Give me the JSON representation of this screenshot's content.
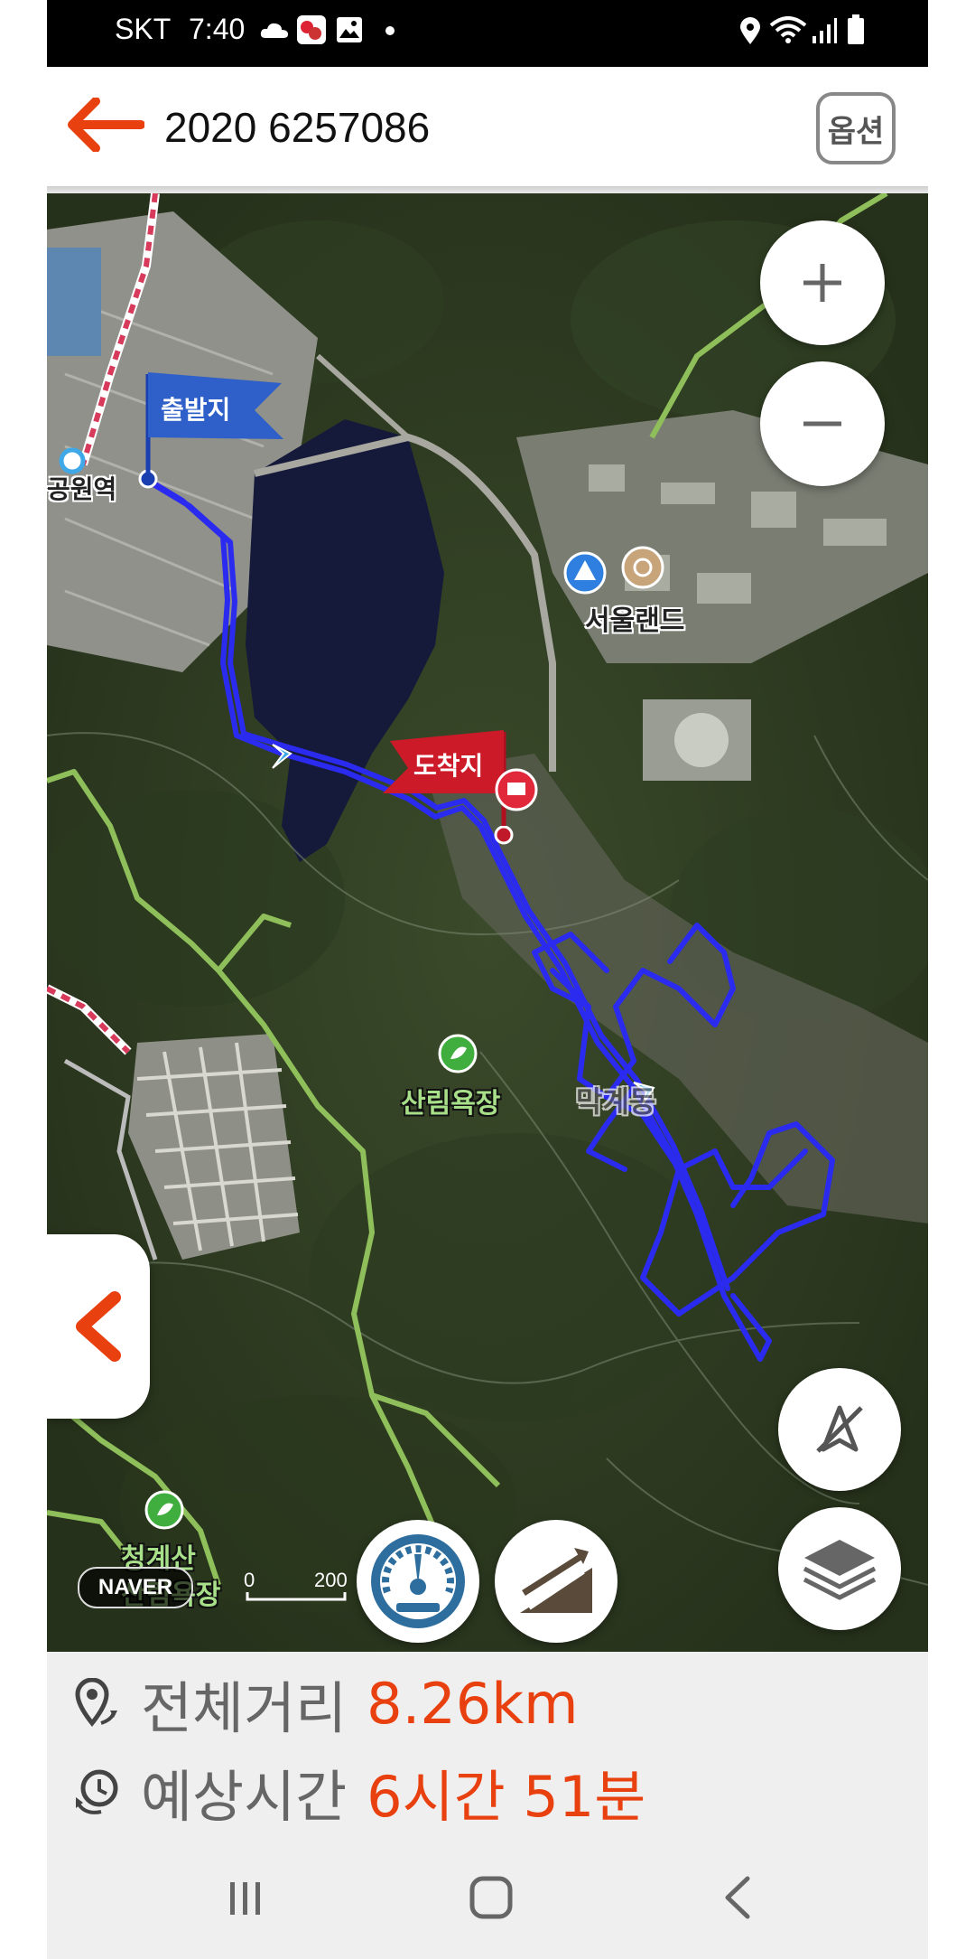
{
  "status_bar": {
    "carrier": "SKT",
    "time": "7:40",
    "icons": [
      "cloud-icon",
      "app-notification-icon",
      "image-icon",
      "dot-icon",
      "location-icon",
      "wifi-icon",
      "signal-icon",
      "battery-icon"
    ]
  },
  "header": {
    "title": "2020 6257086",
    "options_label": "옵션",
    "accent_color": "#e8400e"
  },
  "map": {
    "labels": {
      "station": "공원역",
      "start_flag": "출발지",
      "end_flag": "도착지",
      "seoulland": "서울랜드",
      "forest_bath": "산림욕장",
      "cheonggyesan": "청계산",
      "cheonggyesan_2": "산림욕장",
      "district": "막계동"
    },
    "provider": "NAVER",
    "scale": {
      "start": "0",
      "end": "200"
    },
    "route_color": "#2b2bf0"
  },
  "summary": {
    "distance_label": "전체거리",
    "distance_value": "8.26km",
    "time_label": "예상시간",
    "time_value": "6시간 51분"
  }
}
